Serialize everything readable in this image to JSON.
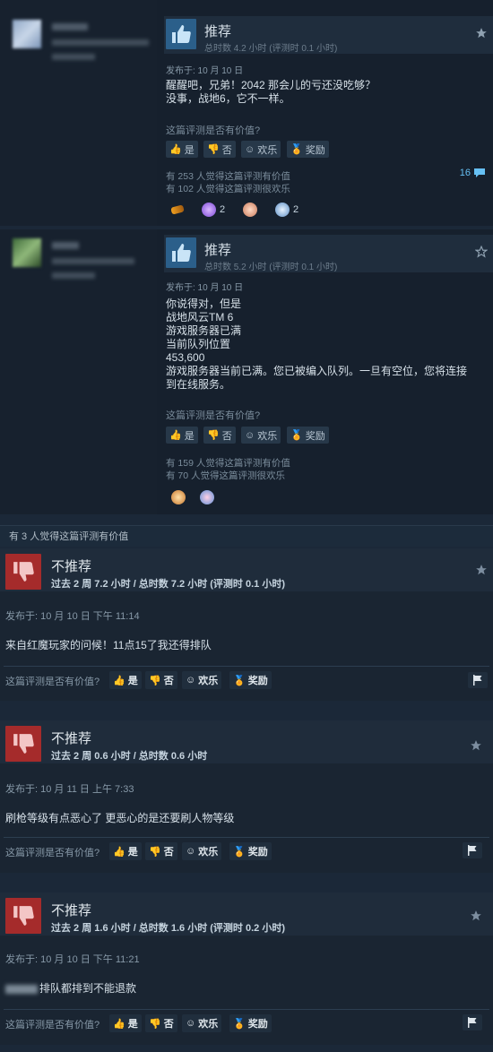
{
  "review1": {
    "title": "推荐",
    "hours": "总时数 4.2 小时   (评测时 0.1 小时)",
    "posted": "发布于: 10 月 10 日",
    "text": "醒醒吧，兄弟！2042 那会儿的亏还没吃够？\n没事，战地6，它不一样。",
    "helpful_q": "这篇评测是否有价值?",
    "btn_yes": "是",
    "btn_no": "否",
    "btn_funny": "欢乐",
    "btn_award": "奖励",
    "stat_helpful": "有 253 人觉得这篇评测有价值",
    "stat_funny": "有 102 人觉得这篇评测很欢乐",
    "comments": "16",
    "award_counts": [
      "2",
      "2"
    ]
  },
  "review2": {
    "title": "推荐",
    "hours": "总时数 5.2 小时   (评测时 0.1 小时)",
    "posted": "发布于: 10 月 10 日",
    "text": "你说得对，但是\n战地风云TM 6\n游戏服务器已满\n当前队列位置\n453,600\n游戏服务器当前已满。您已被编入队列。一旦有空位，您将连接\n到在线服务。",
    "helpful_q": "这篇评测是否有价值?",
    "btn_yes": "是",
    "btn_no": "否",
    "btn_funny": "欢乐",
    "btn_award": "奖励",
    "stat_helpful": "有 159 人觉得这篇评测有价值",
    "stat_funny": "有 70 人觉得这篇评测很欢乐"
  },
  "banner": "有 3 人觉得这篇评测有价值",
  "review3": {
    "title": "不推荐",
    "hours": "过去 2 周 7.2 小时 / 总时数 7.2 小时   (评测时 0.1 小时)",
    "posted": "发布于: 10 月 10 日 下午 11:14",
    "text": "来自红魔玩家的问候！11点15了我还得排队",
    "helpful_q": "这篇评测是否有价值?",
    "btn_yes": "是",
    "btn_no": "否",
    "btn_funny": "欢乐",
    "btn_award": "奖励"
  },
  "review4": {
    "title": "不推荐",
    "hours": "过去 2 周 0.6 小时 / 总时数 0.6 小时",
    "posted": "发布于: 10 月 11 日 上午 7:33",
    "text": "刷枪等级有点恶心了 更恶心的是还要刷人物等级",
    "helpful_q": "这篇评测是否有价值?",
    "btn_yes": "是",
    "btn_no": "否",
    "btn_funny": "欢乐",
    "btn_award": "奖励"
  },
  "review5": {
    "title": "不推荐",
    "hours": "过去 2 周 1.6 小时 / 总时数 1.6 小时   (评测时 0.2 小时)",
    "posted": "发布于: 10 月 10 日 下午 11:21",
    "text": "排队都排到不能退款",
    "helpful_q": "这篇评测是否有价值?",
    "btn_yes": "是",
    "btn_no": "否",
    "btn_funny": "欢乐",
    "btn_award": "奖励"
  },
  "icons": {
    "thumb_up": "thumb-up-icon",
    "thumb_down": "thumb-down-icon",
    "star": "star-icon",
    "flag": "flag-icon",
    "comment": "comment-icon",
    "award": "award-icon"
  },
  "colors": {
    "recommend": "#2b5f8a",
    "not_recommend": "#a52b2b",
    "link": "#66c0f4",
    "award_gold": "#e0b53b"
  }
}
